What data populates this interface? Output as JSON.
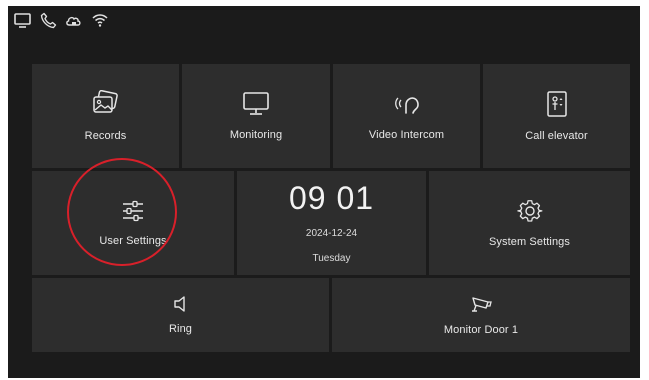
{
  "status_bar": {
    "icons": [
      "monitor-icon",
      "phone-icon",
      "cloud-lock-icon",
      "wifi-icon"
    ]
  },
  "tiles": {
    "records": {
      "label": "Records",
      "icon": "photos-icon"
    },
    "monitoring": {
      "label": "Monitoring",
      "icon": "monitor-icon"
    },
    "video_intercom": {
      "label": "Video Intercom",
      "icon": "intercom-icon"
    },
    "call_elevator": {
      "label": "Call elevator",
      "icon": "elevator-icon"
    },
    "user_settings": {
      "label": "User Settings",
      "icon": "sliders-icon"
    },
    "system_settings": {
      "label": "System Settings",
      "icon": "gear-icon"
    },
    "ring": {
      "label": "Ring",
      "icon": "speaker-icon"
    },
    "monitor_door": {
      "label": "Monitor Door 1",
      "icon": "camera-icon"
    }
  },
  "clock": {
    "time": "09 01",
    "date": "2024-12-24",
    "day": "Tuesday"
  },
  "colors": {
    "screen_bg": "#1b1b1b",
    "tile_bg": "#2d2d2d",
    "highlight": "#d8202a"
  }
}
